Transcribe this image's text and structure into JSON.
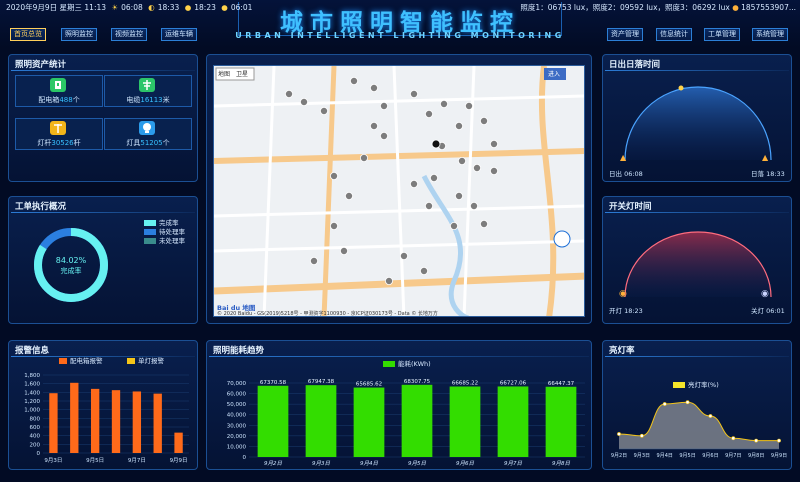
{
  "header": {
    "date": "2020年9月9日 星期三 11:13",
    "sunrise": "06:08",
    "sunset": "18:33",
    "light_on": "18:23",
    "light_off": "06:01",
    "lux": "照度1：06753 lux，照度2：09592 lux，照度3：06292 lux",
    "phone": "1857553907...",
    "title": "城市照明智能监控",
    "subtitle": "URBAN INTELLIGENT LIGHTING MONITORING"
  },
  "nav_left": [
    "首页总览",
    "照明监控",
    "视频监控",
    "运维车辆"
  ],
  "nav_right": [
    "资产管理",
    "信息统计",
    "工单管理",
    "系统管理"
  ],
  "colors": {
    "accent": "#38c0ff",
    "active": "#ffcf5a",
    "bar_green": "#33dd00",
    "bar_orange": "#ff6a1a"
  },
  "assets": {
    "title": "照明资产统计",
    "items": [
      {
        "name": "配电箱",
        "value": "488",
        "unit": "个",
        "icon": "distribution-box-icon",
        "color": "#29c75f"
      },
      {
        "name": "电缆",
        "value": "16113",
        "unit": "米",
        "icon": "cable-icon",
        "color": "#2cc56a"
      },
      {
        "name": "灯杆",
        "value": "30526",
        "unit": "杆",
        "icon": "lamp-pole-icon",
        "color": "#f2b51a"
      },
      {
        "name": "灯具",
        "value": "51205",
        "unit": "个",
        "icon": "lamp-icon",
        "color": "#2b9bea"
      }
    ]
  },
  "workorder": {
    "title": "工单执行概况",
    "percent": "84.02%",
    "label": "完成率",
    "completion": 0.8402,
    "legend": [
      {
        "label": "完成率",
        "color": "#66f1f1"
      },
      {
        "label": "待处理率",
        "color": "#2b7fe0"
      },
      {
        "label": "未处理率",
        "color": "#3a8c8c"
      }
    ]
  },
  "alarm": {
    "title": "报警信息",
    "legend": [
      "配电箱报警",
      "单灯报警"
    ],
    "legend_colors": [
      "#ff6a1a",
      "#f5c518"
    ],
    "chart_data": {
      "type": "bar",
      "categories": [
        "9月3日",
        "",
        "9月5日",
        "",
        "9月7日",
        "",
        "9月9日"
      ],
      "series": [
        {
          "name": "配电箱报警",
          "values": [
            1380,
            1620,
            1480,
            1450,
            1420,
            1370,
            470
          ]
        }
      ],
      "ylim": [
        0,
        1800
      ],
      "yticks": [
        "0",
        "200",
        "400",
        "600",
        "800",
        "1,000",
        "1,200",
        "1,400",
        "1,600",
        "1,800"
      ]
    }
  },
  "energy": {
    "title": "照明能耗趋势",
    "legend": "能耗(KWh)",
    "chart_data": {
      "type": "bar",
      "categories": [
        "9月2日",
        "9月3日",
        "9月4日",
        "9月5日",
        "9月6日",
        "9月7日",
        "9月8日"
      ],
      "series": [
        {
          "name": "能耗(KWh)",
          "values": [
            67370.58,
            67947.38,
            65685.62,
            68307.75,
            66685.22,
            66727.06,
            66447.37
          ]
        }
      ],
      "labels": [
        "67370.58",
        "67947.38",
        "65685.62",
        "68307.75",
        "66685.22",
        "66727.06",
        "66447.37"
      ],
      "ylim": [
        0,
        70000
      ],
      "yticks": [
        "0",
        "10,000",
        "20,000",
        "30,000",
        "40,000",
        "50,000",
        "60,000",
        "70,000"
      ]
    }
  },
  "sun": {
    "title": "日出日落时间",
    "sunrise_label": "日出 06:08",
    "sunset_label": "日落 18:33"
  },
  "switch": {
    "title": "开关灯时间",
    "on_label": "开灯 18:23",
    "off_label": "关灯 06:01"
  },
  "lighting_rate": {
    "title": "亮灯率",
    "legend": "亮灯率(%)",
    "chart_data": {
      "type": "area",
      "categories": [
        "9月2日",
        "9月3日",
        "9月4日",
        "9月5日",
        "9月6日",
        "9月7日",
        "9月8日",
        "9月9日"
      ],
      "values": [
        25,
        22,
        75,
        78,
        55,
        18,
        14,
        14
      ]
    }
  },
  "map": {
    "tab1": "地图",
    "tab2": "卫星",
    "copyright": "© 2020 Baidu - GS(2019)5218号 - 甲测资字1100930 - 京ICP证030173号 - Data © 长地万方",
    "logo": "Bai du 地图",
    "button": "进入"
  }
}
